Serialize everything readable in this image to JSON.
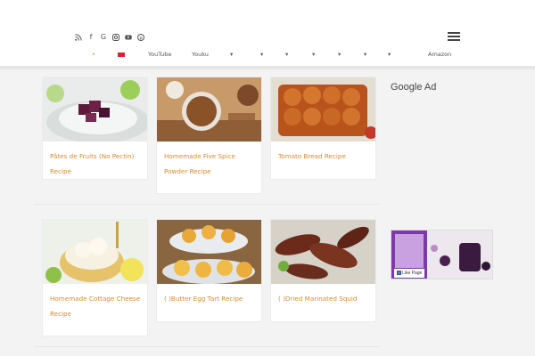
{
  "site": {
    "logo_text": ""
  },
  "social_icons": [
    "rss-icon",
    "facebook-icon",
    "google-icon",
    "instagram-icon",
    "youtube-icon",
    "pinterest-icon"
  ],
  "nav": {
    "items": [
      {
        "label": ""
      },
      {
        "label": "YouTube"
      },
      {
        "label": "Youku"
      },
      {
        "label": "Amazon"
      }
    ]
  },
  "posts": [
    {
      "title": "Pâtes de Fruits (No Pectin) Recipe"
    },
    {
      "title": "Homemade Five Spice Powder Recipe"
    },
    {
      "title": "Tomato Bread Recipe"
    },
    {
      "title": "Homemade Cottage Cheese Recipe"
    },
    {
      "title": "( )Butter Egg Tart Recipe"
    },
    {
      "title": "( )Dried Marinated Squid"
    }
  ],
  "sidebar": {
    "google_ad_title": "Google Ad",
    "fb_like_label": "Like Page"
  },
  "colors": {
    "accent": "#e08a2b",
    "link": "#d98a2f"
  }
}
